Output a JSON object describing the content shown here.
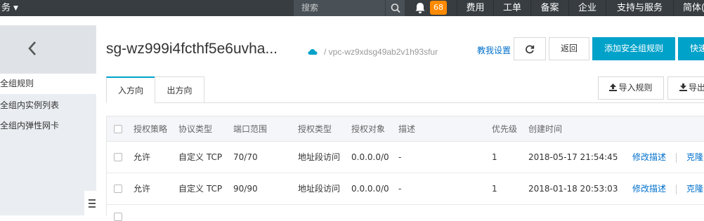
{
  "topbar": {
    "service_label": "务",
    "search_placeholder": "搜索",
    "notification_count": "68",
    "nav": [
      "费用",
      "工单",
      "备案",
      "企业",
      "支持与服务",
      "简体("
    ]
  },
  "sidebar": {
    "items": [
      "全组规则",
      "全组内实例列表",
      "全组内弹性网卡"
    ]
  },
  "header": {
    "title": "sg-wz999i4fcthf5e6uvha...",
    "vpc": "/ vpc-wz9xdsg49ab2v1h93sfur",
    "guide_link": "教我设置",
    "back_button": "返回",
    "add_rule_button": "添加安全组规则",
    "quick_button": "快速"
  },
  "tabs": [
    "入方向",
    "出方向"
  ],
  "toolbar": {
    "import_button": "导入规则",
    "export_button": "导出"
  },
  "table": {
    "columns": [
      "授权策略",
      "协议类型",
      "端口范围",
      "授权类型",
      "授权对象",
      "描述",
      "优先级",
      "创建时间"
    ],
    "rows": [
      [
        "允许",
        "自定义 TCP",
        "70/70",
        "地址段访问",
        "0.0.0.0/0",
        "-",
        "1",
        "2018-05-17 21:54:45"
      ],
      [
        "允许",
        "自定义 TCP",
        "90/90",
        "地址段访问",
        "0.0.0.0/0",
        "-",
        "1",
        "2018-01-18 20:53:03"
      ]
    ],
    "action_edit": "修改描述",
    "action_clone": "克隆"
  }
}
